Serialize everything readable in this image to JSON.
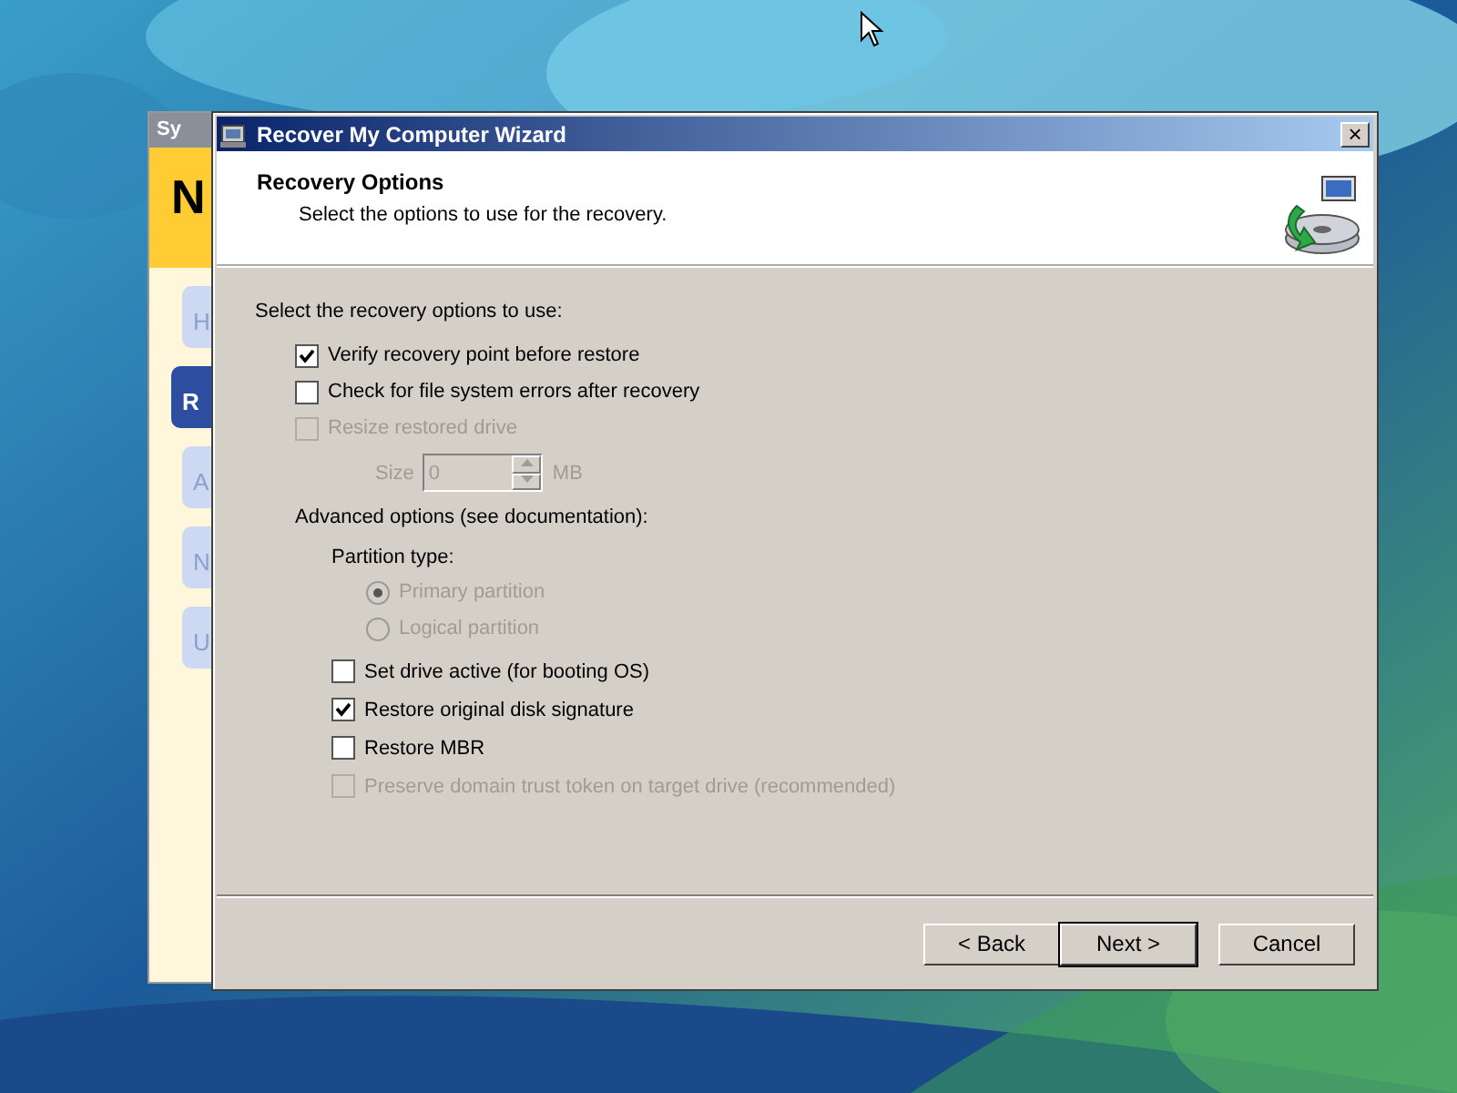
{
  "background_window": {
    "title": "Sy",
    "heading": "N",
    "tabs": [
      {
        "label": "H",
        "selected": false
      },
      {
        "label": "R",
        "selected": true
      },
      {
        "label": "A",
        "selected": false
      },
      {
        "label": "N",
        "selected": false
      },
      {
        "label": "U",
        "selected": false
      }
    ]
  },
  "window": {
    "title": "Recover My Computer Wizard",
    "close": "×"
  },
  "header": {
    "title": "Recovery Options",
    "subtitle": "Select the options to use for the recovery."
  },
  "options_heading": "Select the recovery options to use:",
  "options": [
    {
      "kind": "checkbox",
      "label": "Verify recovery point before restore",
      "checked": true,
      "disabled": false
    },
    {
      "kind": "checkbox",
      "label": "Check for file system errors after recovery",
      "checked": false,
      "disabled": false
    },
    {
      "kind": "checkbox",
      "label": "Resize restored drive",
      "checked": false,
      "disabled": true
    }
  ],
  "size_field": {
    "label": "Size",
    "value": "0",
    "unit": "MB",
    "disabled": true
  },
  "advanced": {
    "heading": "Advanced options (see documentation):",
    "partition_type": {
      "label": "Partition type:",
      "options": [
        {
          "label": "Primary partition",
          "selected": true,
          "disabled": true
        },
        {
          "label": "Logical partition",
          "selected": false,
          "disabled": true
        }
      ]
    },
    "options": [
      {
        "kind": "checkbox",
        "label": "Set drive active (for booting OS)",
        "checked": false,
        "disabled": false
      },
      {
        "kind": "checkbox",
        "label": "Restore original disk signature",
        "checked": true,
        "disabled": false
      },
      {
        "kind": "checkbox",
        "label": "Restore MBR",
        "checked": false,
        "disabled": false
      },
      {
        "kind": "checkbox",
        "label": "Preserve domain trust token on target drive (recommended)",
        "checked": false,
        "disabled": true
      }
    ]
  },
  "buttons": [
    {
      "label": "< Back",
      "default": false
    },
    {
      "label": "Next >",
      "default": true
    },
    {
      "label": "Cancel",
      "default": false
    }
  ]
}
